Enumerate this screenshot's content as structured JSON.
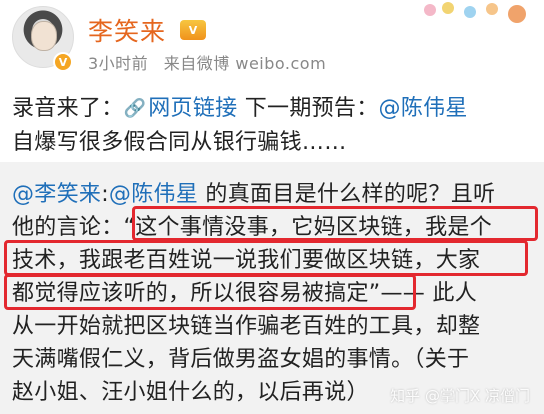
{
  "header": {
    "username": "李笑来",
    "vip_badge": "V",
    "verified_badge": "V",
    "time": "3小时前",
    "source": "来自微博 weibo.com"
  },
  "post": {
    "line1_prefix": "录音来了：",
    "link_text": "网页链接",
    "line1_mid": " 下一期预告：",
    "mention": "@陈伟星",
    "line2": "自爆写很多假合同从银行骗钱……"
  },
  "repost": {
    "mention1": "@李笑来",
    "sep": ":",
    "mention2": "@陈伟星",
    "line1_rest": " 的真面目是什么样的呢？且听",
    "line2": "他的言论：“这个事情没事，它妈区块链，我是个",
    "line3": "技术，我跟老百姓说一说我们要做区块链，大家",
    "line4": "都觉得应该听的，所以很容易被搞定”—— 此人",
    "line5": "从一开始就把区块链当作骗老百姓的工具，却整",
    "line6": "天满嘴假仁义，背后做男盗女娼的事情。（关于",
    "line7": "赵小姐、汪小姐什么的，以后再说）"
  },
  "watermark": "知乎 @掌门X 凉僧门",
  "colors": {
    "username": "#e5661e",
    "link": "#1f6fb9",
    "highlight": "#e3282f",
    "repost_bg": "#f2f2f2"
  }
}
